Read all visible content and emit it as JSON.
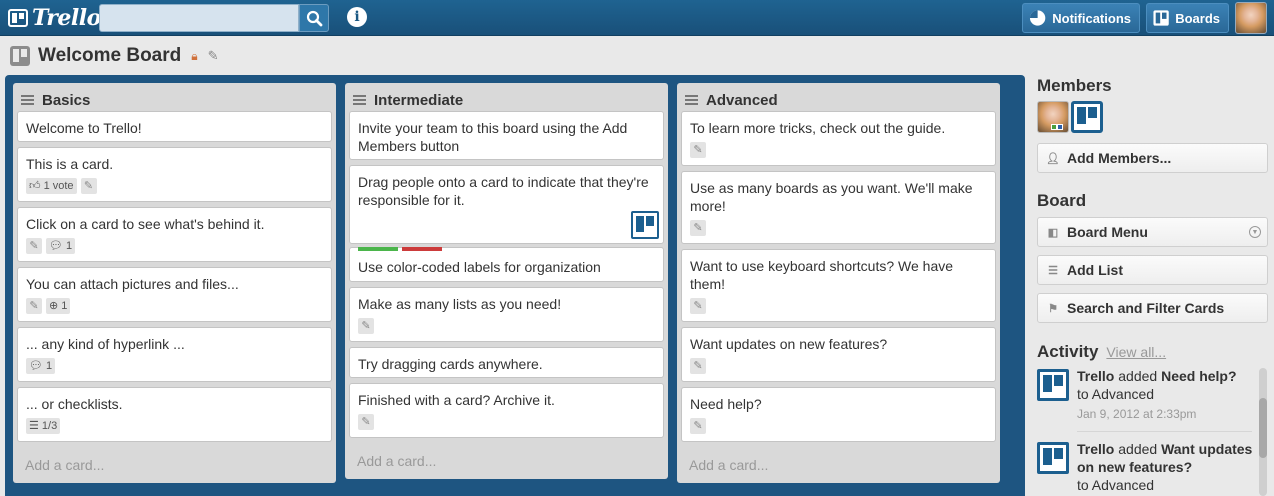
{
  "header": {
    "logo_text": "Trello",
    "search_value": "",
    "notifications_label": "Notifications",
    "boards_label": "Boards"
  },
  "board": {
    "title": "Welcome Board"
  },
  "lists": [
    {
      "title": "Basics",
      "cards": [
        {
          "text": "Welcome to Trello!"
        },
        {
          "text": "This is a card.",
          "votes": "1 vote"
        },
        {
          "text": "Click on a card to see what's behind it.",
          "comments": "1"
        },
        {
          "text": "You can attach pictures and files...",
          "attachments": "1"
        },
        {
          "text": "... any kind of hyperlink ...",
          "comments": "1"
        },
        {
          "text": "... or checklists.",
          "checklist": "1/3"
        }
      ],
      "add_card": "Add a card..."
    },
    {
      "title": "Intermediate",
      "cards": [
        {
          "text": "Invite your team to this board using the Add Members button"
        },
        {
          "text": "Drag people onto a card to indicate that they're responsible for it."
        },
        {
          "text": "Use color-coded labels for organization",
          "labels": [
            "#4bb54b",
            "#cc3b3b"
          ]
        },
        {
          "text": "Make as many lists as you need!"
        },
        {
          "text": "Try dragging cards anywhere."
        },
        {
          "text": "Finished with a card? Archive it."
        }
      ],
      "add_card": "Add a card..."
    },
    {
      "title": "Advanced",
      "cards": [
        {
          "text": "To learn more tricks, check out the guide."
        },
        {
          "text": "Use as many boards as you want. We'll make more!"
        },
        {
          "text": "Want to use keyboard shortcuts? We have them!"
        },
        {
          "text": "Want updates on new features?"
        },
        {
          "text": "Need help?"
        }
      ],
      "add_card": "Add a card..."
    }
  ],
  "sidebar": {
    "members_heading": "Members",
    "add_members_label": "Add Members...",
    "board_heading": "Board",
    "board_menu_label": "Board Menu",
    "add_list_label": "Add List",
    "search_filter_label": "Search and Filter Cards",
    "activity_heading": "Activity",
    "view_all_label": "View all...",
    "activity": [
      {
        "actor": "Trello",
        "verb": "added",
        "item": "Need help?",
        "target": "to Advanced",
        "date": "Jan 9, 2012 at 2:33pm"
      },
      {
        "actor": "Trello",
        "verb": "added",
        "item": "Want updates on new features?",
        "target": "to Advanced"
      }
    ]
  },
  "colors": {
    "header": "#1b5883",
    "board_bg": "#1e5581",
    "label_green": "#4bb54b",
    "label_red": "#cc3b3b"
  }
}
